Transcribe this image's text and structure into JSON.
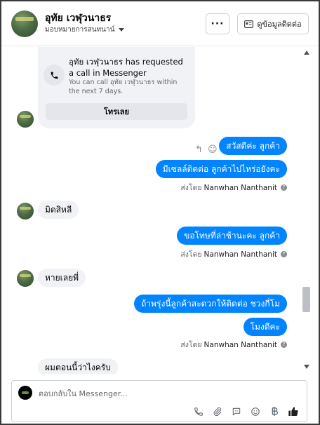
{
  "header": {
    "contact_name": "อุทัย เวฬุวนาธร",
    "contact_subtitle": "มอบหมายการสนทนาน์",
    "more_label": "···",
    "view_contact_label": "ดูข้อมูลติดต่อ"
  },
  "call_request": {
    "title": "อุทัย เวฬุวนาธร has requested a call in Messenger",
    "description": "You can call อุทัย เวฬุวนาธร within the next 7 days.",
    "call_button": "โทรเลย"
  },
  "messages": [
    {
      "direction": "out",
      "text": "สวัสดีค่ะ ลูกค้า"
    },
    {
      "direction": "out",
      "text": "มีเซลล์ติดต่อ ลูกค้าไปไหร่อยังคะ"
    },
    {
      "direction": "in",
      "text": "มิดสิหลี"
    },
    {
      "direction": "out",
      "text": "ขอโทษที่ล่าช้านะคะ ลูกค้า"
    },
    {
      "direction": "in",
      "text": "หายเลยพี่"
    },
    {
      "direction": "out",
      "text": "ถ้าพรุ่งนี้ลูกค้าสะดวกให้ติดต่อ ชวงกี่โม"
    },
    {
      "direction": "out",
      "text": "โมงดีคะ"
    },
    {
      "direction": "in",
      "text": "ผมตอนนี้ว่าไงครับ"
    }
  ],
  "sent_by": {
    "prefix": "ส่งโดย",
    "name": "Nanwhan Nanthanit",
    "info": "?"
  },
  "composer": {
    "placeholder": "ตอบกลับใน Messenger..."
  },
  "colors": {
    "outgoing_bubble": "#0084ff",
    "incoming_bubble": "#f0f2f5",
    "send_like": "#1c1e21"
  },
  "icons": [
    "phone-icon",
    "reply-icon",
    "emoji-icon",
    "call-icon",
    "attachment-icon",
    "sticker-icon",
    "emoji-composer-icon",
    "baht-icon",
    "like-icon",
    "id-card-icon"
  ]
}
